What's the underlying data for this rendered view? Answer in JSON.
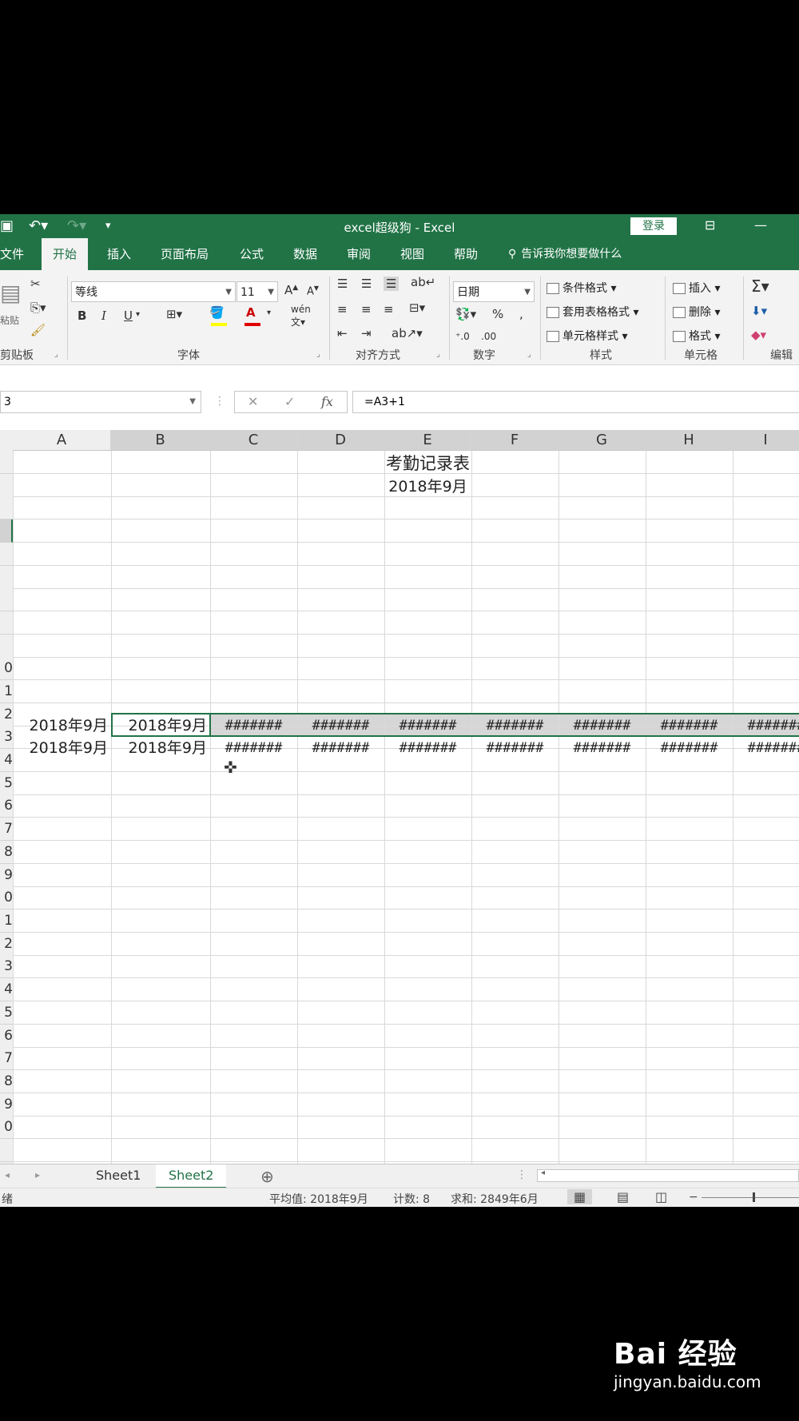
{
  "window": {
    "title": "excel超级狗 - Excel",
    "login_label": "登录",
    "min_label": "—"
  },
  "tabs": [
    "文件",
    "开始",
    "插入",
    "页面布局",
    "公式",
    "数据",
    "审阅",
    "视图",
    "帮助"
  ],
  "tell_me": "告诉我你想要做什么",
  "ribbon": {
    "clipboard_label": "剪贴板",
    "paste_label": "粘贴",
    "font_name": "等线",
    "font_size": "11",
    "font_group_label": "字体",
    "bold": "B",
    "italic": "I",
    "underline": "U",
    "align_group_label": "对齐方式",
    "number_format": "日期",
    "number_group_label": "数字",
    "percent": "%",
    "cond_format": "条件格式",
    "table_format": "套用表格格式",
    "cell_style": "单元格样式",
    "styles_group_label": "样式",
    "insert": "插入",
    "delete": "删除",
    "format": "格式",
    "cells_group_label": "单元格",
    "edit_group_label": "编辑"
  },
  "formula_bar": {
    "name_box": "3",
    "cancel": "✕",
    "enter": "✓",
    "fx": "fx",
    "formula": "=A3+1"
  },
  "columns": [
    "A",
    "B",
    "C",
    "D",
    "E",
    "F",
    "G",
    "H",
    "I"
  ],
  "row_numbers": [
    "0",
    "1",
    "2",
    "3",
    "4",
    "5",
    "6",
    "7",
    "8",
    "9",
    "0",
    "1",
    "2",
    "3",
    "4",
    "5",
    "6",
    "7",
    "8",
    "9",
    "0"
  ],
  "cells": {
    "title": "考勤记录表",
    "subtitle": "2018年9月",
    "row3": [
      "2018年9月",
      "2018年9月",
      "#######",
      "#######",
      "#######",
      "#######",
      "#######",
      "#######",
      "#######"
    ],
    "row4": [
      "2018年9月",
      "2018年9月",
      "#######",
      "#######",
      "#######",
      "#######",
      "#######",
      "#######",
      "#######"
    ]
  },
  "sheets": [
    "Sheet1",
    "Sheet2"
  ],
  "active_sheet": "Sheet2",
  "status": {
    "mode": "绪",
    "average": "平均值: 2018年9月",
    "count": "计数: 8",
    "sum": "求和: 2849年6月"
  },
  "watermark": {
    "brand": "Bai 经验",
    "url": "jingyan.baidu.com"
  },
  "colors": {
    "accent": "#217346"
  }
}
